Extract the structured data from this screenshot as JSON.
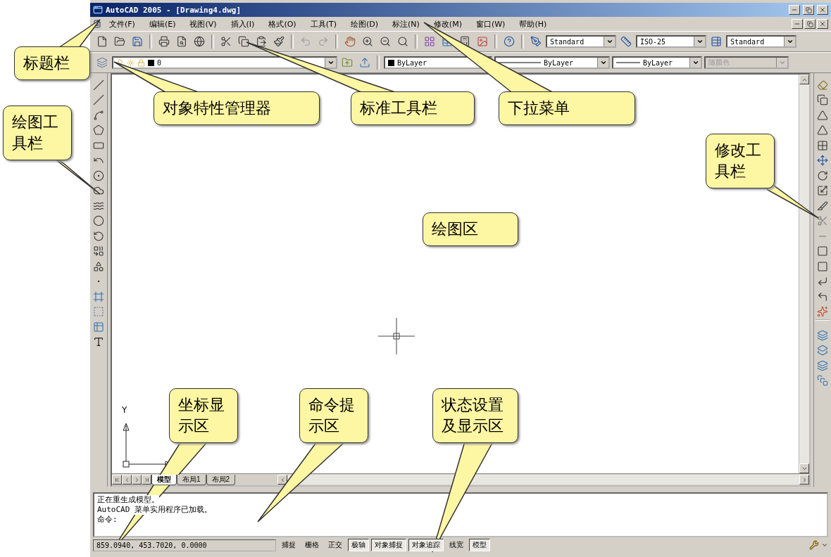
{
  "window": {
    "title": "AutoCAD 2005 - [Drawing4.dwg]"
  },
  "menu": [
    "文件(F)",
    "编辑(E)",
    "视图(V)",
    "插入(I)",
    "格式(O)",
    "工具(T)",
    "绘图(D)",
    "标注(N)",
    "修改(M)",
    "窗口(W)",
    "帮助(H)"
  ],
  "styles_toolbar": [
    "Standard",
    "ISO-25",
    "Standard"
  ],
  "properties_toolbar": {
    "layer": "0",
    "color_setting": "ByLayer",
    "linetype": "ByLayer",
    "lineweight": "ByLayer",
    "plot_style": {
      "value": "随颜色",
      "disabled": true
    }
  },
  "drawing_area": {
    "axis_label": "Y"
  },
  "layout_tabs": [
    {
      "label": "模型",
      "selected": true
    },
    {
      "label": "布局1",
      "selected": false
    },
    {
      "label": "布局2",
      "selected": false
    }
  ],
  "command_lines": [
    "正在重生成模型。",
    "AutoCAD 菜单实用程序已加载。",
    "命令:"
  ],
  "status_bar": {
    "coordinates": "859.0940, 453.7020, 0.0000",
    "toggles": [
      {
        "label": "捕捉",
        "on": false
      },
      {
        "label": "栅格",
        "on": false
      },
      {
        "label": "正交",
        "on": false
      },
      {
        "label": "极轴",
        "on": true
      },
      {
        "label": "对象捕捉",
        "on": true
      },
      {
        "label": "对象追踪",
        "on": true
      },
      {
        "label": "线宽",
        "on": false
      },
      {
        "label": "模型",
        "on": true
      }
    ]
  },
  "callouts": [
    "标题栏",
    "对象特性管理器",
    "标准工具栏",
    "下拉菜单",
    "绘图工具栏",
    "修改工具栏",
    "绘图区",
    "坐标显示区",
    "命令提示区",
    "状态设置及显示区"
  ]
}
